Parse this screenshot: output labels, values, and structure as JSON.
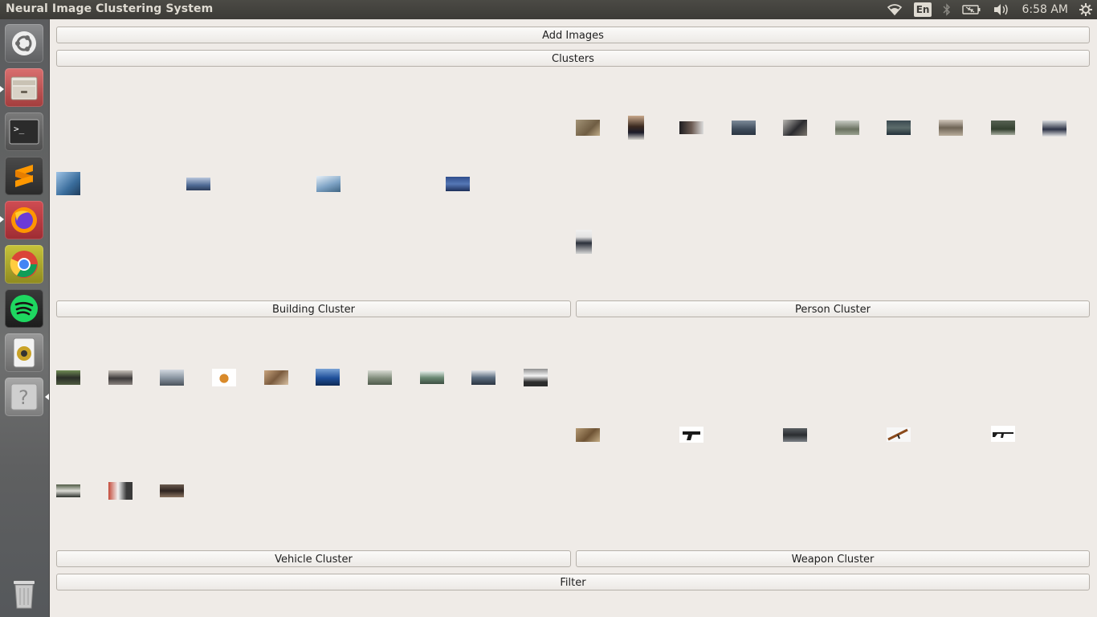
{
  "window": {
    "title": "Neural Image Clustering System"
  },
  "tray": {
    "language": "En",
    "clock": "6:58 AM"
  },
  "launcher": {
    "items": [
      "ubuntu-dash",
      "files",
      "terminal",
      "sublime-text",
      "firefox",
      "chrome",
      "spotify",
      "rhythmbox",
      "help",
      "trash"
    ]
  },
  "buttons": {
    "add_images": "Add Images",
    "clusters": "Clusters",
    "building_cluster": "Building Cluster",
    "person_cluster": "Person Cluster",
    "vehicle_cluster": "Vehicle Cluster",
    "weapon_cluster": "Weapon Cluster",
    "filter": "Filter"
  },
  "clusters": {
    "building": {
      "image_count": 4
    },
    "person": {
      "image_count": 11
    },
    "vehicle": {
      "image_count": 13
    },
    "weapon": {
      "image_count": 5
    }
  },
  "colors": {
    "window_bg": "#efebe7",
    "topbar_bg": "#3c3b37",
    "launcher_bg": "#626463"
  }
}
